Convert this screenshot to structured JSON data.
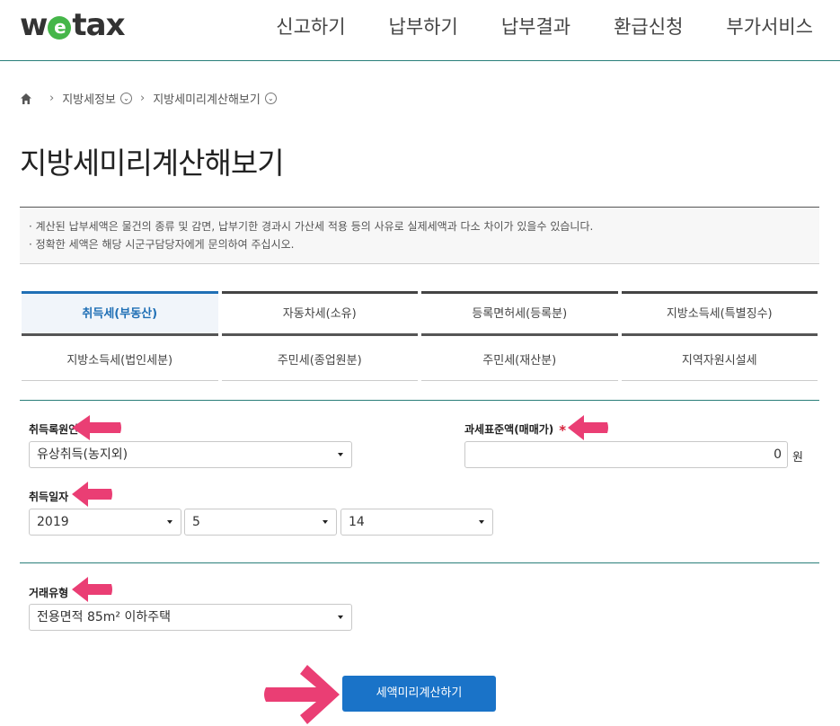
{
  "header": {
    "logo": {
      "w": "w",
      "e": "e",
      "rest": "tax"
    },
    "nav": [
      "신고하기",
      "납부하기",
      "납부결과",
      "환급신청",
      "부가서비스"
    ]
  },
  "breadcrumb": {
    "items": [
      "지방세정보",
      "지방세미리계산해보기"
    ]
  },
  "page_title": "지방세미리계산해보기",
  "notice": {
    "lines": [
      "· 계산된 납부세액은 물건의 종류 및 감면, 납부기한 경과시 가산세 적용 등의 사유로 실제세액과 다소 차이가 있을수 있습니다.",
      "· 정확한 세액은 해당 시군구담당자에게 문의하여 주십시오."
    ]
  },
  "tabs": {
    "row1": [
      "취득세(부동산)",
      "자동차세(소유)",
      "등록면허세(등록분)",
      "지방소득세(특별징수)"
    ],
    "row2": [
      "지방소득세(법인세분)",
      "주민세(종업원분)",
      "주민세(재산분)",
      "지역자원시설세"
    ],
    "active": "취득세(부동산)"
  },
  "form": {
    "acquisition_cause": {
      "label": "취득록원인",
      "value": "유상취득(농지외)"
    },
    "tax_base": {
      "label": "과세표준액(매매가)",
      "required_mark": "*",
      "value": "0",
      "unit": "원"
    },
    "acquisition_date": {
      "label": "취득일자",
      "year": "2019",
      "month": "5",
      "day": "14"
    },
    "transaction_type": {
      "label": "거래유형",
      "value": "전용면적 85m² 이하주택"
    }
  },
  "submit_label": "세액미리계산하기",
  "colors": {
    "accent": "#1a73c8",
    "teal": "#2a7f7a",
    "arrow": "#ea3e74",
    "required": "#d6213a"
  }
}
